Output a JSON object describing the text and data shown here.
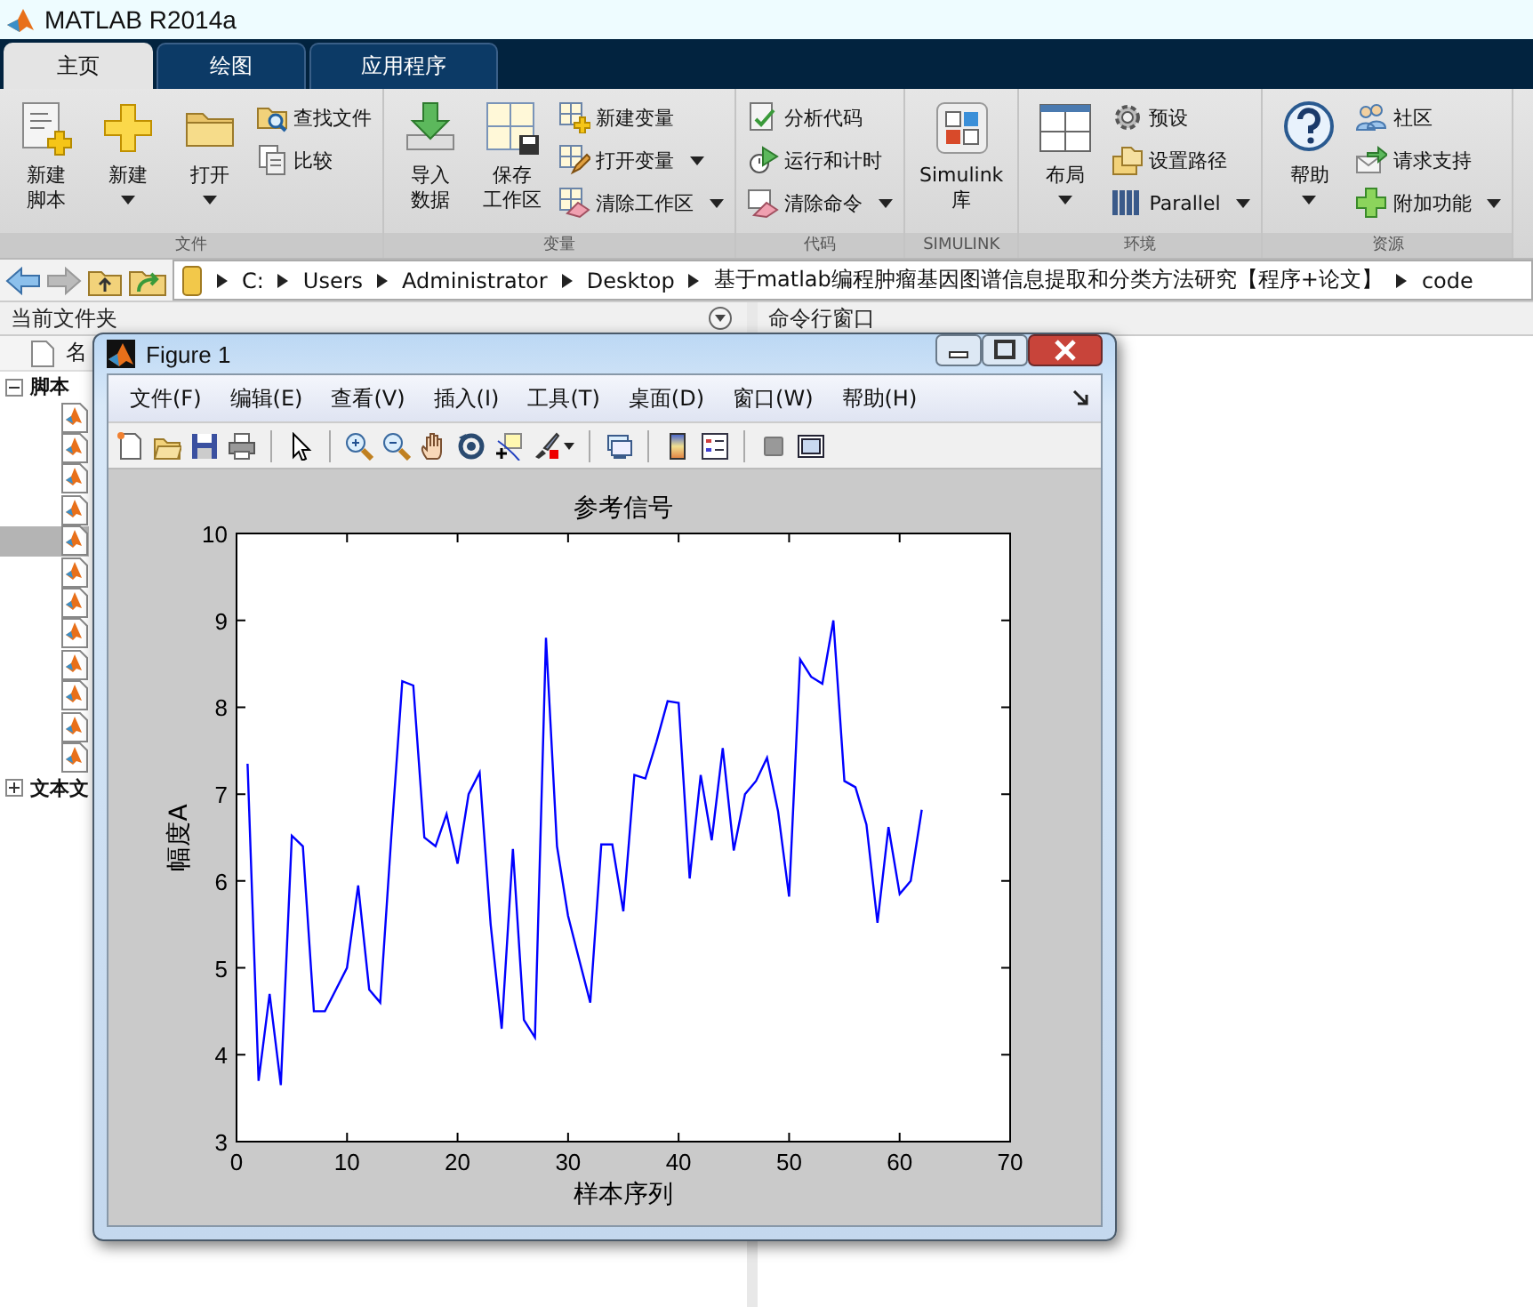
{
  "window": {
    "title": "MATLAB R2014a"
  },
  "tabs": [
    {
      "label": "主页",
      "selected": true
    },
    {
      "label": "绘图",
      "selected": false
    },
    {
      "label": "应用程序",
      "selected": false
    }
  ],
  "ribbon": {
    "groups": [
      {
        "label": "文件",
        "items": [
          {
            "lines": [
              "新建",
              "脚本"
            ],
            "kind": "large",
            "dropdown": false
          },
          {
            "lines": [
              "新建"
            ],
            "kind": "large",
            "dropdown": true
          },
          {
            "lines": [
              "打开"
            ],
            "kind": "large",
            "dropdown": true
          },
          {
            "label": "查找文件",
            "kind": "small",
            "dropdown": false
          },
          {
            "label": "比较",
            "kind": "small",
            "dropdown": false
          }
        ]
      },
      {
        "label": "变量",
        "items": [
          {
            "lines": [
              "导入",
              "数据"
            ],
            "kind": "large",
            "dropdown": false
          },
          {
            "lines": [
              "保存",
              "工作区"
            ],
            "kind": "large",
            "dropdown": false
          },
          {
            "label": "新建变量",
            "kind": "small",
            "dropdown": false
          },
          {
            "label": "打开变量",
            "kind": "small",
            "dropdown": true
          },
          {
            "label": "清除工作区",
            "kind": "small",
            "dropdown": true
          }
        ]
      },
      {
        "label": "代码",
        "items": [
          {
            "label": "分析代码",
            "kind": "small",
            "dropdown": false
          },
          {
            "label": "运行和计时",
            "kind": "small",
            "dropdown": false
          },
          {
            "label": "清除命令",
            "kind": "small",
            "dropdown": true
          }
        ]
      },
      {
        "label": "SIMULINK",
        "items": [
          {
            "lines": [
              "Simulink",
              "库"
            ],
            "kind": "large",
            "dropdown": false
          }
        ]
      },
      {
        "label": "环境",
        "items": [
          {
            "lines": [
              "布局"
            ],
            "kind": "large",
            "dropdown": true
          },
          {
            "label": "预设",
            "kind": "small",
            "dropdown": false
          },
          {
            "label": "设置路径",
            "kind": "small",
            "dropdown": false
          },
          {
            "label": "Parallel",
            "kind": "small",
            "dropdown": true
          }
        ]
      },
      {
        "label": "资源",
        "items": [
          {
            "lines": [
              "帮助"
            ],
            "kind": "large",
            "dropdown": true
          },
          {
            "label": "社区",
            "kind": "small",
            "dropdown": false
          },
          {
            "label": "请求支持",
            "kind": "small",
            "dropdown": false
          },
          {
            "label": "附加功能",
            "kind": "small",
            "dropdown": true
          }
        ]
      }
    ]
  },
  "address_bar": {
    "path": [
      "C:",
      "Users",
      "Administrator",
      "Desktop",
      "基于matlab编程肿瘤基因图谱信息提取和分类方法研究【程序+论文】",
      "code"
    ]
  },
  "current_folder": {
    "title": "当前文件夹",
    "column_header": "名",
    "tree": [
      {
        "label": "脚本",
        "expanded": true,
        "children": [
          {
            "selected": false
          },
          {
            "selected": false
          },
          {
            "selected": false
          },
          {
            "selected": false
          },
          {
            "selected": true
          },
          {
            "selected": false
          },
          {
            "selected": false
          },
          {
            "selected": false
          },
          {
            "selected": false
          },
          {
            "selected": false
          },
          {
            "selected": false
          },
          {
            "selected": false
          }
        ]
      },
      {
        "label": "文本文",
        "expanded": false
      }
    ]
  },
  "command_window": {
    "title": "命令行窗口"
  },
  "figure": {
    "title": "Figure 1",
    "menu": [
      "文件(F)",
      "编辑(E)",
      "查看(V)",
      "插入(I)",
      "工具(T)",
      "桌面(D)",
      "窗口(W)",
      "帮助(H)"
    ],
    "chart_data": {
      "type": "line",
      "title": "参考信号",
      "xlabel": "样本序列",
      "ylabel": "幅度A",
      "x": [
        1,
        2,
        3,
        4,
        5,
        6,
        7,
        8,
        9,
        10,
        11,
        12,
        13,
        14,
        15,
        16,
        17,
        18,
        19,
        20,
        21,
        22,
        23,
        24,
        25,
        26,
        27,
        28,
        29,
        30,
        31,
        32,
        33,
        34,
        35,
        36,
        37,
        38,
        39,
        40,
        41,
        42,
        43,
        44,
        45,
        46,
        47,
        48,
        49,
        50,
        51,
        52,
        53,
        54,
        55,
        56,
        57,
        58,
        59,
        60,
        61,
        62
      ],
      "series": [
        {
          "color": "#0000ff",
          "values": [
            7.35,
            3.7,
            4.7,
            3.65,
            6.52,
            6.4,
            4.5,
            4.5,
            4.75,
            5.0,
            5.95,
            4.75,
            4.6,
            6.5,
            8.3,
            8.25,
            6.5,
            6.4,
            6.77,
            6.2,
            7.0,
            7.25,
            5.5,
            4.3,
            6.37,
            4.4,
            4.2,
            8.8,
            6.4,
            5.6,
            5.1,
            4.6,
            6.42,
            6.42,
            5.65,
            7.22,
            7.18,
            7.6,
            8.07,
            8.05,
            6.03,
            7.22,
            6.47,
            7.53,
            6.35,
            7.0,
            7.15,
            7.42,
            6.8,
            5.82,
            8.55,
            8.35,
            8.27,
            9.0,
            7.15,
            7.08,
            6.65,
            5.52,
            6.62,
            5.85,
            6.0,
            6.82
          ]
        }
      ],
      "xlim": [
        0,
        70
      ],
      "ylim": [
        3,
        10
      ],
      "xticks": [
        0,
        10,
        20,
        30,
        40,
        50,
        60,
        70
      ],
      "yticks": [
        3,
        4,
        5,
        6,
        7,
        8,
        9,
        10
      ]
    }
  }
}
